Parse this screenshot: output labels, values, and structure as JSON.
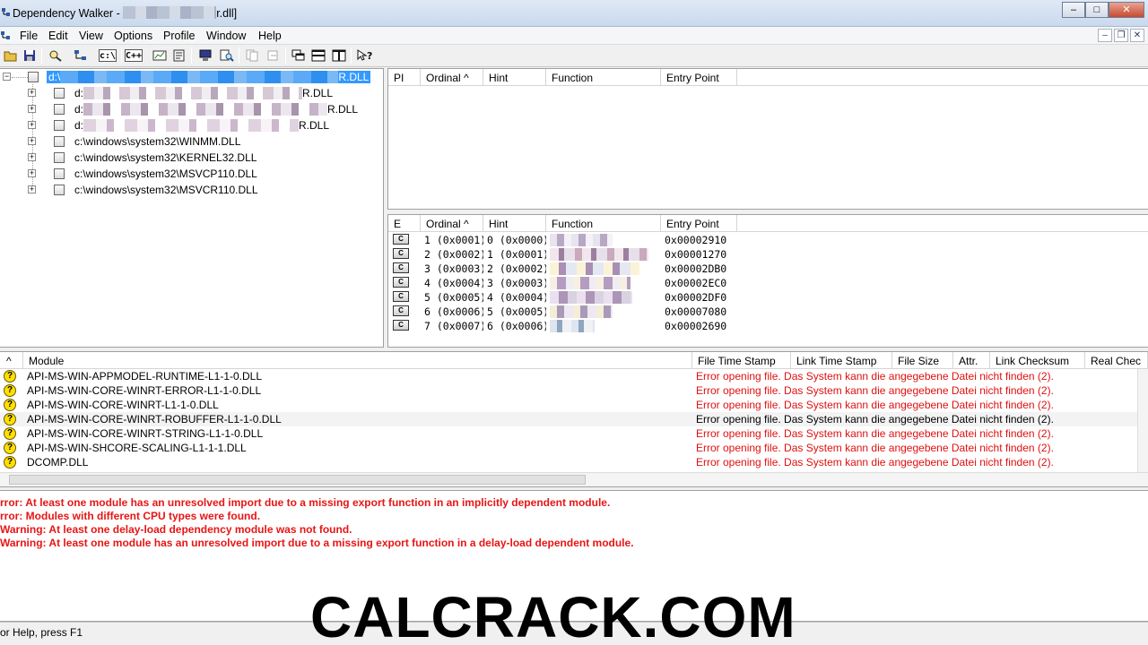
{
  "window": {
    "title_prefix": "Dependency Walker - ",
    "title_suffix": "r.dll]",
    "minimize": "‒",
    "maximize": "□",
    "close": "✕"
  },
  "menu": {
    "items": [
      "File",
      "Edit",
      "View",
      "Options",
      "Profile",
      "Window",
      "Help"
    ],
    "mdi_min": "–",
    "mdi_restore": "❐",
    "mdi_close": "✕"
  },
  "toolbar": {
    "cpath_label": "c:\\",
    "cpp_label": "C++"
  },
  "tree": {
    "root": {
      "prefix": "d:\\",
      "suffix": "R.DLL"
    },
    "children": [
      {
        "prefix": "d:",
        "suffix": "R.DLL"
      },
      {
        "prefix": "d:",
        "suffix": "R.DLL"
      },
      {
        "prefix": "d:",
        "suffix": "R.DLL"
      },
      {
        "label": "c:\\windows\\system32\\WINMM.DLL"
      },
      {
        "label": "c:\\windows\\system32\\KERNEL32.DLL"
      },
      {
        "label": "c:\\windows\\system32\\MSVCP110.DLL"
      },
      {
        "label": "c:\\windows\\system32\\MSVCR110.DLL"
      }
    ]
  },
  "imports": {
    "columns": [
      "PI",
      "Ordinal ^",
      "Hint",
      "Function",
      "Entry Point"
    ]
  },
  "exports": {
    "columns": [
      "E",
      "Ordinal ^",
      "Hint",
      "Function",
      "Entry Point"
    ],
    "icon_label": "C",
    "rows": [
      {
        "ordinal": "1 (0x0001)",
        "hint": "0 (0x0000)",
        "entry": "0x00002910"
      },
      {
        "ordinal": "2 (0x0002)",
        "hint": "1 (0x0001)",
        "entry": "0x00001270"
      },
      {
        "ordinal": "3 (0x0003)",
        "hint": "2 (0x0002)",
        "entry": "0x00002DB0"
      },
      {
        "ordinal": "4 (0x0004)",
        "hint": "3 (0x0003)",
        "entry": "0x00002EC0"
      },
      {
        "ordinal": "5 (0x0005)",
        "hint": "4 (0x0004)",
        "entry": "0x00002DF0"
      },
      {
        "ordinal": "6 (0x0006)",
        "hint": "5 (0x0005)",
        "entry": "0x00007080"
      },
      {
        "ordinal": "7 (0x0007)",
        "hint": "6 (0x0006)",
        "entry": "0x00002690"
      }
    ]
  },
  "modules": {
    "columns": [
      "^",
      "Module",
      "File Time Stamp",
      "Link Time Stamp",
      "File Size",
      "Attr.",
      "Link Checksum",
      "Real Chec"
    ],
    "status_icon": "?",
    "rows": [
      {
        "name": "API-MS-WIN-APPMODEL-RUNTIME-L1-1-0.DLL",
        "status": "Error opening file. Das System kann die angegebene Datei nicht finden (2).",
        "error": true
      },
      {
        "name": "API-MS-WIN-CORE-WINRT-ERROR-L1-1-0.DLL",
        "status": "Error opening file. Das System kann die angegebene Datei nicht finden (2).",
        "error": true
      },
      {
        "name": "API-MS-WIN-CORE-WINRT-L1-1-0.DLL",
        "status": "Error opening file. Das System kann die angegebene Datei nicht finden (2).",
        "error": true
      },
      {
        "name": "API-MS-WIN-CORE-WINRT-ROBUFFER-L1-1-0.DLL",
        "status": "Error opening file. Das System kann die angegebene Datei nicht finden (2).",
        "error": false
      },
      {
        "name": "API-MS-WIN-CORE-WINRT-STRING-L1-1-0.DLL",
        "status": "Error opening file. Das System kann die angegebene Datei nicht finden (2).",
        "error": true
      },
      {
        "name": "API-MS-WIN-SHCORE-SCALING-L1-1-1.DLL",
        "status": "Error opening file. Das System kann die angegebene Datei nicht finden (2).",
        "error": true
      },
      {
        "name": "DCOMP.DLL",
        "status": "Error opening file. Das System kann die angegebene Datei nicht finden (2).",
        "error": true
      }
    ]
  },
  "log": [
    "rror: At least one module has an unresolved import due to a missing export function in an implicitly dependent module.",
    "rror: Modules with different CPU types were found.",
    "Warning: At least one delay-load dependency module was not found.",
    "Warning: At least one module has an unresolved import due to a missing export function in a delay-load dependent module."
  ],
  "status": "or Help, press F1",
  "watermark": "CALCRACK.COM",
  "colors": {
    "error": "#e01010",
    "selection": "#3399ff",
    "warning_icon": "#ffe000"
  }
}
